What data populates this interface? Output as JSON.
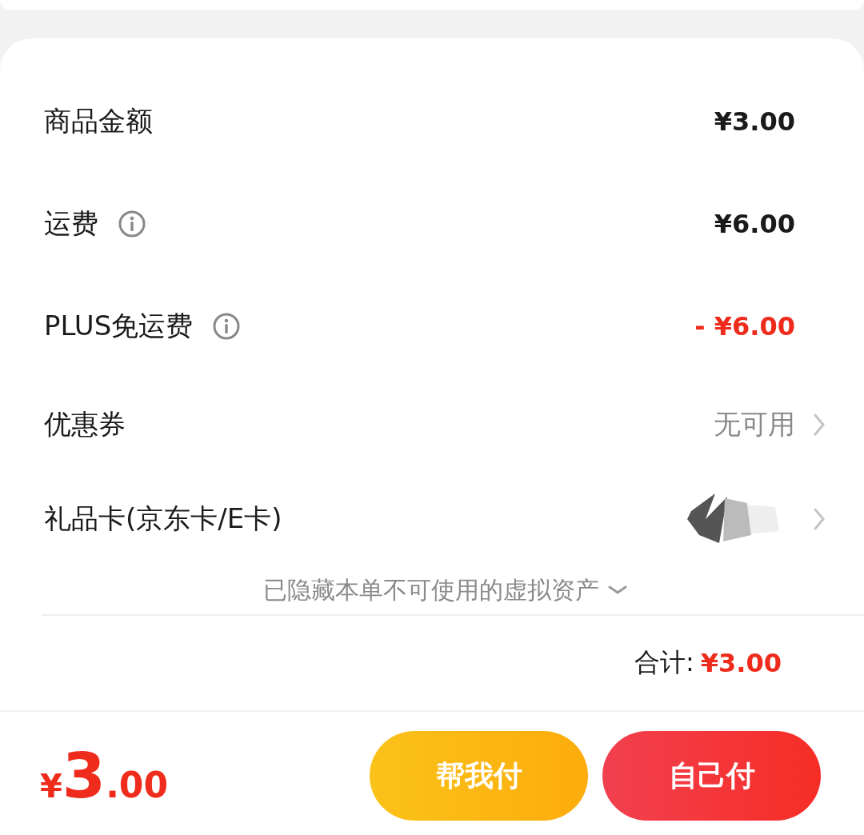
{
  "rows": [
    {
      "label": "商品金额",
      "info": false,
      "value": "¥3.00",
      "kind": "amount",
      "chevron": false
    },
    {
      "label": "运费",
      "info": true,
      "value": "¥6.00",
      "kind": "amount",
      "chevron": false
    },
    {
      "label": "PLUS免运费",
      "info": true,
      "value": "- ¥6.00",
      "kind": "discount",
      "chevron": false
    },
    {
      "label": "优惠券",
      "info": false,
      "value": "无可用",
      "kind": "muted",
      "chevron": true
    },
    {
      "label": "礼品卡(京东卡/E卡)",
      "info": false,
      "kind": "redacted",
      "chevron": true
    }
  ],
  "hidden_note": "已隐藏本单不可使用的虚拟资产",
  "total": {
    "label": "合计:",
    "value": "¥3.00"
  },
  "footer": {
    "currency": "¥",
    "integer": "3",
    "decimal": ".00",
    "buttons": [
      {
        "label": "帮我付",
        "kind": "friend"
      },
      {
        "label": "自己付",
        "kind": "self"
      }
    ]
  }
}
